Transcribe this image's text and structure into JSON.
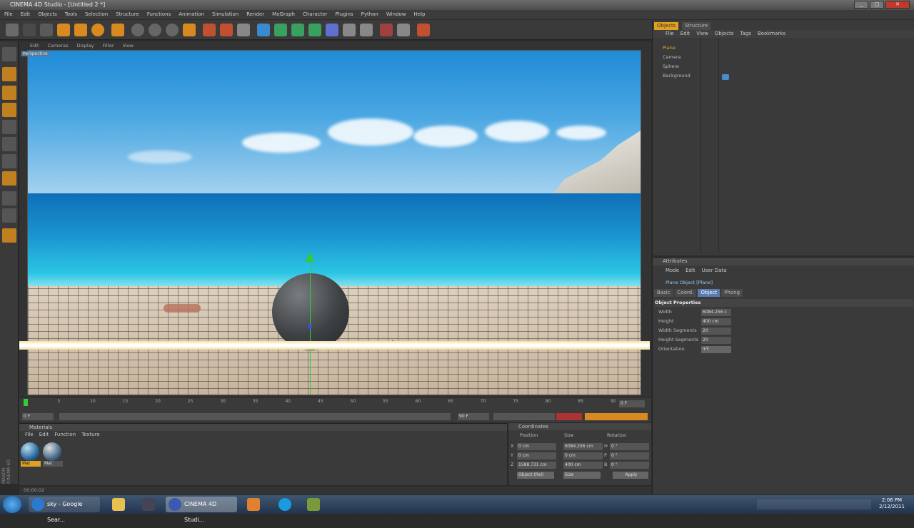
{
  "window": {
    "title": "CINEMA 4D Studio - [Untitled 2 *]"
  },
  "menu": [
    "File",
    "Edit",
    "Objects",
    "Tools",
    "Selection",
    "Structure",
    "Functions",
    "Animation",
    "Simulation",
    "Render",
    "MoGraph",
    "Character",
    "Plugins",
    "Python",
    "Window",
    "Help"
  ],
  "viewport": {
    "menu": [
      "Edit",
      "Cameras",
      "Display",
      "Filter",
      "View"
    ],
    "label": "Perspective"
  },
  "timeline": {
    "ticks": [
      "0",
      "5",
      "10",
      "15",
      "20",
      "25",
      "30",
      "35",
      "40",
      "45",
      "50",
      "55",
      "60",
      "65",
      "70",
      "75",
      "80",
      "85",
      "90"
    ],
    "end_frame": "0 F",
    "start_field": "0 F",
    "max_field": "90 F"
  },
  "materials": {
    "title": "Materials",
    "menu": [
      "File",
      "Edit",
      "Function",
      "Texture"
    ],
    "items": [
      {
        "label": "Mat"
      },
      {
        "label": "Mat"
      }
    ]
  },
  "coordinates": {
    "title": "Coordinates",
    "headers": [
      "Position",
      "Size",
      "Rotation"
    ],
    "rows": [
      {
        "axis": "X",
        "pos": "0 cm",
        "size": "6084.256 cm",
        "rot_axis": "H",
        "rot": "0 °"
      },
      {
        "axis": "Y",
        "pos": "0 cm",
        "size": "0 cm",
        "rot_axis": "P",
        "rot": "0 °"
      },
      {
        "axis": "Z",
        "pos": "1588.731 cm",
        "size": "400 cm",
        "rot_axis": "B",
        "rot": "0 °"
      }
    ],
    "mode": "Object (Rel)",
    "size_mode": "Size",
    "apply": "Apply"
  },
  "status": {
    "time": "00:00:02"
  },
  "objects": {
    "tabs": [
      "Objects",
      "Structure"
    ],
    "menu": [
      "File",
      "Edit",
      "View",
      "Objects",
      "Tags",
      "Bookmarks"
    ],
    "items": [
      "Plane",
      "Camera",
      "Sphere",
      "Background"
    ]
  },
  "attributes": {
    "title": "Attributes",
    "menu": [
      "Mode",
      "Edit",
      "User Data"
    ],
    "object_title": "Plane Object [Plane]",
    "tabs": [
      "Basic",
      "Coord.",
      "Object",
      "Phong"
    ],
    "section": "Object Properties",
    "props": [
      {
        "label": "Width",
        "value": "6084.256 c"
      },
      {
        "label": "Height",
        "value": "400 cm"
      },
      {
        "label": "Width Segments",
        "value": "20"
      },
      {
        "label": "Height Segments",
        "value": "20"
      },
      {
        "label": "Orientation",
        "value": "+Y"
      }
    ]
  },
  "taskbar": {
    "items": [
      "sky - Google Sear...",
      "CINEMA 4D Studi..."
    ],
    "clock_time": "2:06 PM",
    "clock_date": "2/12/2011"
  },
  "side_logo": "MAXON CINEMA 4D"
}
